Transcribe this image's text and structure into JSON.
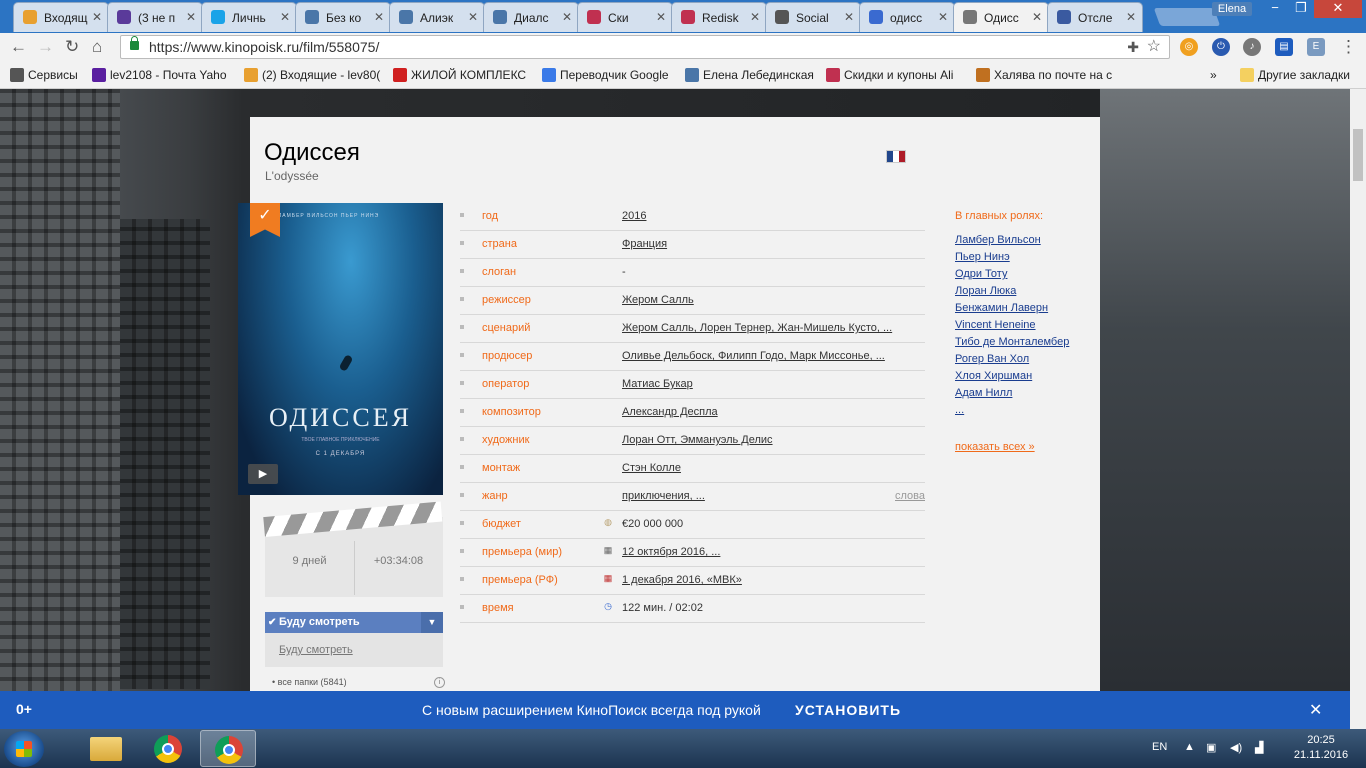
{
  "tabs": [
    {
      "label": "Входящ",
      "icon": "at-icon",
      "color": "#e8a030"
    },
    {
      "label": "(3 не п",
      "icon": "mail-icon",
      "color": "#5a3a9a"
    },
    {
      "label": "Личнь",
      "icon": "chat-icon",
      "color": "#1aa3e8"
    },
    {
      "label": "Без ко",
      "icon": "vk-icon",
      "color": "#4a76a8"
    },
    {
      "label": "Алиэк",
      "icon": "vk-icon",
      "color": "#4a76a8"
    },
    {
      "label": "Диалс",
      "icon": "dialog-icon",
      "color": "#4a76a8"
    },
    {
      "label": "Ски",
      "icon": "berry-icon",
      "color": "#c03050"
    },
    {
      "label": "Redisk",
      "icon": "berry-icon",
      "color": "#c03050"
    },
    {
      "label": "Social",
      "icon": "circle-icon",
      "color": "#555555"
    },
    {
      "label": "одисс",
      "icon": "search-icon",
      "color": "#3a6ad0"
    },
    {
      "label": "Одисс",
      "icon": "film-icon",
      "color": "#777777"
    },
    {
      "label": "Отсле",
      "icon": "emblem-icon",
      "color": "#3a5aa0"
    }
  ],
  "window": {
    "user": "Elena",
    "minimize": "−",
    "maximize": "❐",
    "close": "✕"
  },
  "toolbar": {
    "url": "https://www.kinopoisk.ru/film/558075/"
  },
  "bookmarks": [
    {
      "label": "Сервисы",
      "icon": "apps-icon"
    },
    {
      "label": "lev2108 - Почта Yaho",
      "icon": "yahoo-icon"
    },
    {
      "label": "(2) Входящие - lev80(",
      "icon": "at-icon"
    },
    {
      "label": "ЖИЛОЙ КОМПЛЕКС",
      "icon": "e1-icon"
    },
    {
      "label": "Переводчик Google",
      "icon": "translate-icon"
    },
    {
      "label": "Елена Лебединская",
      "icon": "vk-icon"
    },
    {
      "label": "Скидки и купоны Ali",
      "icon": "berry-icon"
    },
    {
      "label": "Халява по почте на с",
      "icon": "gift-icon"
    }
  ],
  "bookmarks_more": "»",
  "bookmarks_other": "Другие закладки",
  "film": {
    "title": "Одиссея",
    "original_title": "L'odyssée",
    "poster_title": "ОДИССЕЯ",
    "poster_subtitle": "ТВОЕ ГЛАВНОЕ ПРИКЛЮЧЕНИЕ",
    "poster_date": "С 1 ДЕКАБРЯ",
    "poster_names": "ЛАМБЕР ВИЛЬСОН   ПЬЕР НИНЭ"
  },
  "countdown": {
    "days": "9 дней",
    "time": "+03:34:08"
  },
  "watch": {
    "button": "Буду смотреть",
    "link": "Буду смотреть",
    "folders": "все папки (5841)"
  },
  "info": [
    {
      "key": "год",
      "value": "2016",
      "linked": true
    },
    {
      "key": "страна",
      "value": "Франция",
      "linked": true
    },
    {
      "key": "слоган",
      "value": "-",
      "linked": false
    },
    {
      "key": "режиссер",
      "value": "Жером Салль",
      "linked": true
    },
    {
      "key": "сценарий",
      "value": "Жером Салль, Лорен Тернер, Жан-Мишель Кусто, ...",
      "linked": true
    },
    {
      "key": "продюсер",
      "value": "Оливье Дельбоск, Филипп Годо, Марк Миссонье, ...",
      "linked": true
    },
    {
      "key": "оператор",
      "value": "Матиас Букар",
      "linked": true
    },
    {
      "key": "композитор",
      "value": "Александр Деспла",
      "linked": true
    },
    {
      "key": "художник",
      "value": "Лоран Отт, Эммануэль Делис",
      "linked": true
    },
    {
      "key": "монтаж",
      "value": "Стэн Колле",
      "linked": true
    },
    {
      "key": "жанр",
      "value": "приключения, ...",
      "linked": true,
      "extra": "слова"
    },
    {
      "key": "бюджет",
      "value": "€20 000 000",
      "linked": false,
      "icon": "coin-icon"
    },
    {
      "key": "премьера (мир)",
      "value": "12 октября 2016, ...",
      "linked": true,
      "icon": "calendar-icon"
    },
    {
      "key": "премьера (РФ)",
      "value": "1 декабря 2016, «МВК»",
      "linked": true,
      "icon": "calendar-add-icon"
    },
    {
      "key": "время",
      "value": "122 мин. / 02:02",
      "linked": false,
      "icon": "clock-icon"
    }
  ],
  "cast": {
    "heading": "В главных ролях:",
    "actors": [
      "Ламбер Вильсон",
      "Пьер Нинэ",
      "Одри Тоту",
      "Лоран Люка",
      "Бенжамин Лаверн",
      "Vincent Heneine",
      "Тибо де Монталембер",
      "Рогер Ван Хол",
      "Хлоя Хиршман",
      "Адам Нилл",
      "..."
    ],
    "show_all": "показать всех »"
  },
  "banner": {
    "age": "0+",
    "message": "С новым расширением КиноПоиск всегда под рукой",
    "install": "УСТАНОВИТЬ",
    "close": "✕"
  },
  "taskbar": {
    "lang": "EN",
    "time": "20:25",
    "date": "21.11.2016"
  },
  "colors": {
    "accent": "#f06a1a",
    "banner": "#1e5cbe",
    "tabstrip": "#2c74c3"
  }
}
